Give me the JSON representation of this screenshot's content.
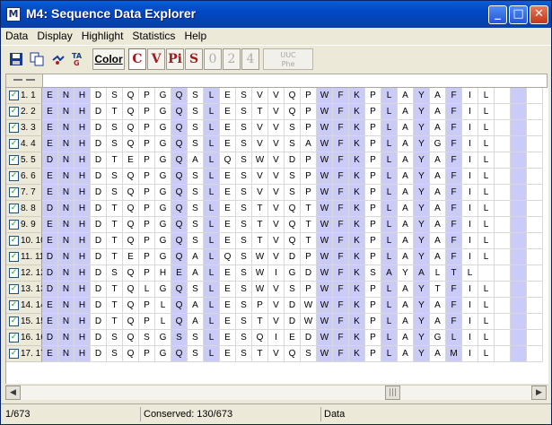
{
  "window": {
    "title": "M4: Sequence Data Explorer",
    "icon_letter": "M",
    "minimize_glyph": "_",
    "maximize_glyph": "□",
    "close_glyph": "✕"
  },
  "menu": [
    "Data",
    "Display",
    "Highlight",
    "Statistics",
    "Help"
  ],
  "toolbar": {
    "color_label": "Color",
    "highlight_buttons": [
      "C",
      "V",
      "Pi",
      "S",
      "0",
      "2",
      "4"
    ],
    "uuc_top": "UUC",
    "uuc_bottom": "Phe",
    "icons": [
      "save-icon",
      "copy-icon",
      "translate-icon",
      "text-format-icon"
    ]
  },
  "highlight_color": "#cbcbf8",
  "highlighted_columns": [
    1,
    2,
    3,
    9,
    11,
    18,
    19,
    20,
    22,
    24,
    26,
    30
  ],
  "sequences": [
    {
      "label": "1. 1",
      "checked": true,
      "residues": "ENHDSQPGQSLESVVQPWFKPLAYAFIL"
    },
    {
      "label": "2. 2",
      "checked": true,
      "residues": "ENHDTQPGQSLESTVQPWFKPLAYAFIL"
    },
    {
      "label": "3. 3",
      "checked": true,
      "residues": "ENHDSQPGQSLESVVSPWFKPLAYAFIL"
    },
    {
      "label": "4. 4",
      "checked": true,
      "residues": "ENHDSQPGQSLESVVSAWFKPLAYGFIL"
    },
    {
      "label": "5. 5",
      "checked": true,
      "residues": "DNHDTEPGQALQSWVDPWFKPLAYAFIL"
    },
    {
      "label": "6. 6",
      "checked": true,
      "residues": "ENHDSQPGQSLESVVSPWFKPLAYAFIL"
    },
    {
      "label": "7. 7",
      "checked": true,
      "residues": "ENHDSQPGQSLESVVSPWFKPLAYAFIL"
    },
    {
      "label": "8. 8",
      "checked": true,
      "residues": "DNHDTQPGQSLESTVQTWFKPLAYAFIL"
    },
    {
      "label": "9. 9",
      "checked": true,
      "residues": "ENHDTQPGQSLESTVQTWFKPLAYAFIL"
    },
    {
      "label": "10. 10",
      "checked": true,
      "residues": "ENHDTQPGQSLESTVQTWFKPLAYAFIL"
    },
    {
      "label": "11. 11",
      "checked": true,
      "residues": "DNHDTEPGQALQSWVDPWFKPLAYAFIL"
    },
    {
      "label": "12. 12",
      "checked": true,
      "residues": "DNHDSQPHEALESWIGDWFKSAYALTL"
    },
    {
      "label": "13. 13",
      "checked": true,
      "residues": "DNHDTQLGQSLESWVSPWFKPLAYTFIL"
    },
    {
      "label": "14. 14",
      "checked": true,
      "residues": "ENHDTQPLQALESPVDWWFKPLAYAFIL"
    },
    {
      "label": "15. 15",
      "checked": true,
      "residues": "ENHDTQPLQALESTVDWWFKPLAYAFIL"
    },
    {
      "label": "16. 16",
      "checked": true,
      "residues": "DNHDSQSGSSLESQIEDWFKPLAYGLIL"
    },
    {
      "label": "17. 17",
      "checked": true,
      "residues": "ENHDSQPGQSLESTVQSWFKPLAYAMIL"
    }
  ],
  "scrollbar": {
    "left_arrow": "◀",
    "right_arrow": "▶",
    "thumb_glyph": "|||"
  },
  "status": {
    "position": "1/673",
    "conserved": "Conserved: 130/673",
    "mode": "Data"
  }
}
